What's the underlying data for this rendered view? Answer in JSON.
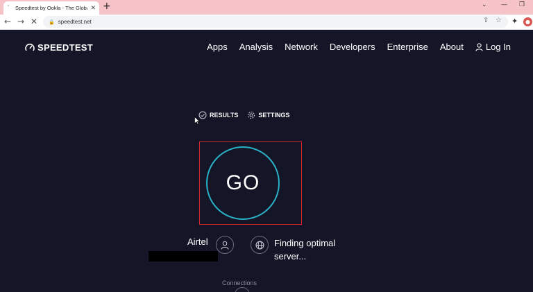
{
  "browser": {
    "tab_title": "Speedtest by Ookla - The Global",
    "url": "speedtest.net"
  },
  "header": {
    "logo_text": "SPEEDTEST",
    "nav": [
      "Apps",
      "Analysis",
      "Network",
      "Developers",
      "Enterprise",
      "About"
    ],
    "login_label": "Log In"
  },
  "links": {
    "results": "RESULTS",
    "settings": "SETTINGS"
  },
  "go_label": "GO",
  "isp_name": "Airtel",
  "server_status": "Finding optimal server...",
  "connections_label": "Connections",
  "colors": {
    "background": "#141526",
    "accent": "#2bb1c7",
    "highlight": "#d42a2a"
  }
}
